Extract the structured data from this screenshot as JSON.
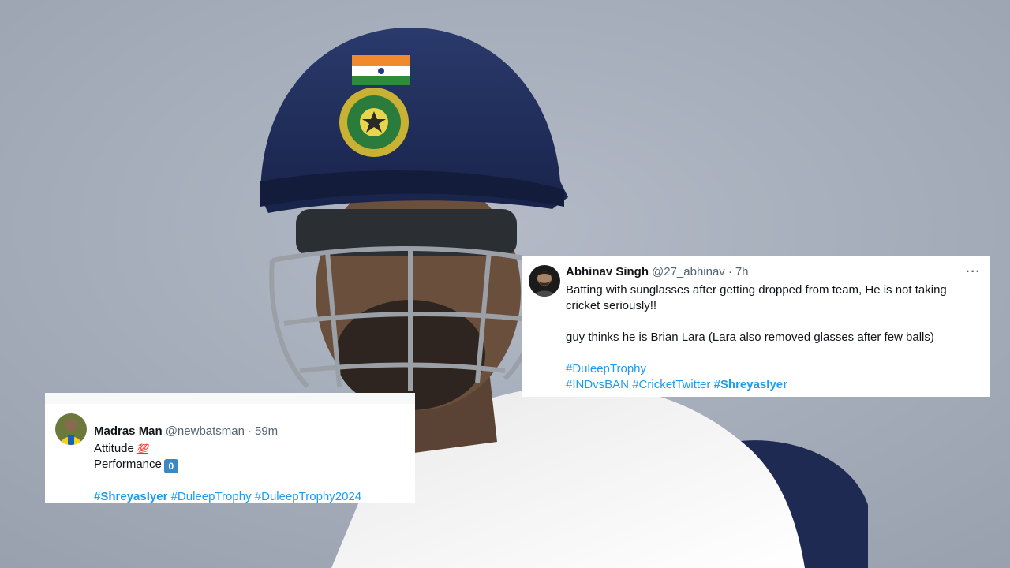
{
  "background": {
    "description_colors": {
      "sky": "#a9b0bd",
      "helmet": "#1f2d5a",
      "shirt": "#f2f2f2"
    }
  },
  "tweets": [
    {
      "name": "Abhinav Singh",
      "handle": "@27_abhinav",
      "separator": "·",
      "time": "7h",
      "more_label": "···",
      "lines": [
        "Batting with sunglasses after getting dropped from team, He is not taking",
        "cricket seriously!!",
        "guy thinks he is Brian Lara (Lara also removed glasses after few balls)"
      ],
      "hashtags_line1": [
        "#DuleepTrophy"
      ],
      "hashtags_line2": [
        "#INDvsBAN",
        "#CricketTwitter",
        "#ShreyasIyer"
      ]
    },
    {
      "name": "Madras Man",
      "handle": "@newbatsman",
      "separator": "·",
      "time": "59m",
      "line1": "Attitude",
      "emoji1": "💯",
      "line2": "Performance",
      "emoji2": "0",
      "hashtags": [
        "#ShreyasIyer",
        "#DuleepTrophy",
        "#DuleepTrophy2024"
      ]
    }
  ],
  "colors": {
    "accent": "#1d9bf0",
    "text": "#0f1419",
    "muted": "#536471"
  }
}
